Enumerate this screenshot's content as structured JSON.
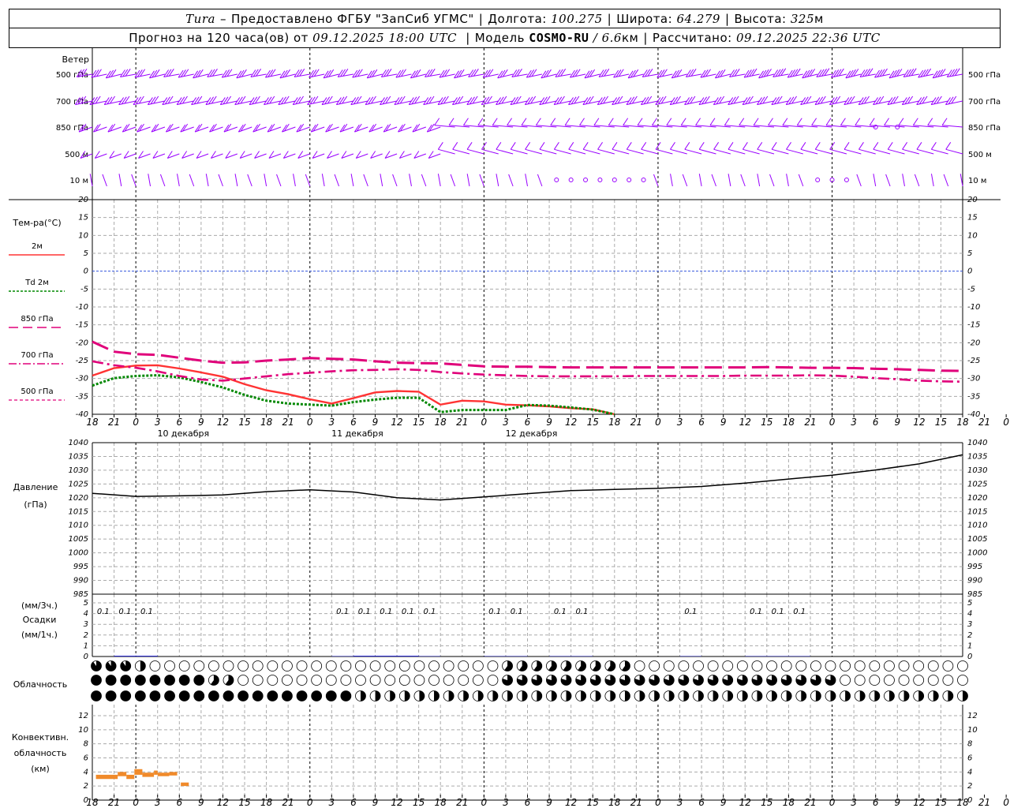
{
  "header": {
    "station": "Tura",
    "dash": "–",
    "provider": "Предоставлено ФГБУ \"ЗапСиб УГМС\"",
    "lon_label": "Долгота:",
    "lon": "100.275",
    "lat_label": "Широта:",
    "lat": "64.279",
    "alt_label": "Высота:",
    "alt": "325",
    "alt_unit": "м",
    "forecast_prefix": "Прогноз на 120 часа(ов) от",
    "forecast_start": "09.12.2025 18:00 UTC",
    "model_label": "Модель",
    "model": "COSMO-RU",
    "model_res": "/ 6.6",
    "model_res_unit": "км",
    "computed_label": "Рассчитано:",
    "computed": "09.12.2025 22:36 UTC"
  },
  "time_axis": {
    "hour_labels": [
      "18",
      "21",
      "0",
      "3",
      "6",
      "9",
      "12",
      "15",
      "18",
      "21",
      "0",
      "3",
      "6",
      "9",
      "12",
      "15",
      "18",
      "21",
      "0",
      "3",
      "6",
      "9",
      "12",
      "15",
      "18",
      "21",
      "0",
      "3",
      "6",
      "9",
      "12",
      "15",
      "18",
      "21",
      "0",
      "3",
      "6",
      "9",
      "12",
      "15",
      "18",
      "21",
      "0"
    ],
    "day_labels": [
      "10 декабря",
      "11 декабря",
      "12 декабря"
    ]
  },
  "wind_panel": {
    "title": "Ветер",
    "levels": [
      "500 гПа",
      "700 гПа",
      "850 гПа",
      "500 м",
      "10 м"
    ],
    "barb_color": "#9900ff"
  },
  "temperature_panel": {
    "title": "Тем-ра(°C)",
    "legend": [
      "2м",
      "Td 2м",
      "850 гПа",
      "700 гПа",
      "500 гПа"
    ],
    "y_ticks": [
      "20",
      "15",
      "10",
      "5",
      "0",
      "-5",
      "-10",
      "-15",
      "-20",
      "-25",
      "-30",
      "-35",
      "-40"
    ]
  },
  "pressure_panel": {
    "title": "Давление",
    "unit": "(гПа)",
    "y_ticks": [
      "1040",
      "1035",
      "1030",
      "1025",
      "1020",
      "1015",
      "1010",
      "1005",
      "1000",
      "995",
      "990",
      "985"
    ]
  },
  "precip_panel": {
    "unit_top": "(мм/3ч.)",
    "title": "Осадки",
    "unit_bottom": "(мм/1ч.)",
    "y_ticks": [
      "5",
      "4",
      "3",
      "2",
      "1",
      "0"
    ],
    "value_label": "0.1"
  },
  "cloud_panel": {
    "title": "Облачность"
  },
  "convective_panel": {
    "title_1": "Конвективн.",
    "title_2": "облачность",
    "unit": "(км)",
    "y_ticks": [
      "12",
      "10",
      "8",
      "6",
      "4",
      "2",
      "0"
    ]
  },
  "chart_data": [
    {
      "type": "line",
      "panel": "temperature",
      "x_hours": [
        0,
        3,
        6,
        9,
        12,
        15,
        18,
        21,
        24,
        27,
        30,
        33,
        36,
        39,
        42,
        45,
        48,
        51,
        54,
        57,
        60,
        63,
        66,
        69,
        72,
        75,
        78,
        81,
        84,
        87,
        90,
        93,
        96,
        99,
        102,
        105,
        108,
        111,
        114,
        117,
        120
      ],
      "ylim": [
        -40,
        20
      ],
      "series": [
        {
          "name": "2м",
          "color": "#ff3333",
          "values": [
            -29.2,
            -27.1,
            -26.4,
            -26.3,
            -27.2,
            -28.3,
            -29.5,
            -31.6,
            -33.3,
            -34.4,
            -35.8,
            -37.0,
            -35.5,
            -33.9,
            -33.5,
            -33.7,
            -37.3,
            -36.2,
            -36.4,
            -37.3,
            -37.5,
            -37.8,
            -38.3,
            -38.6,
            -40.0,
            null,
            null,
            null,
            null,
            null,
            null,
            null,
            null,
            null,
            null,
            null,
            null,
            null,
            null,
            null,
            null
          ]
        },
        {
          "name": "Td 2м",
          "color": "#008800",
          "values": [
            -32.0,
            -29.9,
            -29.3,
            -29.1,
            -29.7,
            -31.0,
            -32.5,
            -34.6,
            -36.2,
            -37.0,
            -37.3,
            -37.6,
            -36.6,
            -35.9,
            -35.4,
            -35.4,
            -39.4,
            -38.8,
            -38.8,
            -38.8,
            -37.4,
            -37.6,
            -38.1,
            -38.7,
            -40.0,
            null,
            null,
            null,
            null,
            null,
            null,
            null,
            null,
            null,
            null,
            null,
            null,
            null,
            null,
            null,
            null
          ]
        },
        {
          "name": "850 гПа",
          "color": "#e0007a",
          "values": [
            -19.7,
            -22.5,
            -23.2,
            -23.4,
            -24.2,
            -25.0,
            -25.6,
            -25.5,
            -25.0,
            -24.7,
            -24.3,
            -24.5,
            -24.7,
            -25.2,
            -25.6,
            -25.7,
            -25.8,
            -26.2,
            -26.6,
            -26.7,
            -26.7,
            -26.8,
            -26.9,
            -26.9,
            -26.9,
            -26.9,
            -26.9,
            -26.9,
            -26.9,
            -26.9,
            -26.9,
            -26.8,
            -26.9,
            -27.0,
            -27.0,
            -27.1,
            -27.3,
            -27.4,
            -27.6,
            -27.8,
            -27.9
          ]
        },
        {
          "name": "700 гПа",
          "color": "#e0007a",
          "values": [
            -25.2,
            -26.3,
            -27.0,
            -28.0,
            -29.3,
            -30.3,
            -30.6,
            -30.0,
            -29.4,
            -28.8,
            -28.4,
            -28.0,
            -27.7,
            -27.6,
            -27.4,
            -27.6,
            -28.2,
            -28.6,
            -28.9,
            -29.1,
            -29.3,
            -29.4,
            -29.4,
            -29.4,
            -29.4,
            -29.3,
            -29.3,
            -29.3,
            -29.3,
            -29.3,
            -29.2,
            -29.2,
            -29.2,
            -29.1,
            -29.2,
            -29.5,
            -29.9,
            -30.2,
            -30.6,
            -30.8,
            -30.9
          ]
        }
      ]
    },
    {
      "type": "line",
      "panel": "pressure",
      "x_hours": [
        0,
        6,
        12,
        18,
        24,
        30,
        36,
        42,
        48,
        54,
        60,
        66,
        72,
        78,
        84,
        90,
        96,
        102,
        108,
        114,
        120
      ],
      "ylim": [
        985,
        1040
      ],
      "series": [
        {
          "name": "Давление",
          "color": "#000000",
          "values": [
            1021.6,
            1020.5,
            1020.7,
            1021.0,
            1022.2,
            1022.9,
            1022.1,
            1020.0,
            1019.2,
            1020.3,
            1021.5,
            1022.6,
            1023.0,
            1023.4,
            1024.1,
            1025.3,
            1026.8,
            1028.2,
            1030.1,
            1032.3,
            1035.6
          ]
        }
      ]
    },
    {
      "type": "bar",
      "panel": "precipitation",
      "x_hours": [
        0,
        3,
        6,
        9,
        12,
        15,
        18,
        21,
        24,
        27,
        30,
        33,
        36,
        39,
        42,
        45,
        48,
        51,
        54,
        57,
        60,
        63,
        66,
        69,
        72,
        75,
        78,
        81,
        84,
        87,
        90,
        93,
        96,
        99,
        102,
        105,
        108,
        111,
        114,
        117,
        120
      ],
      "ylim": [
        0,
        5
      ],
      "series": [
        {
          "name": "мм/3ч",
          "labels_shown": "0.1",
          "values": [
            0.1,
            0.1,
            0.1,
            0,
            0,
            0,
            0,
            0,
            0,
            0,
            0,
            0.1,
            0.1,
            0.1,
            0.1,
            0.1,
            0,
            0,
            0.1,
            0.1,
            0,
            0.1,
            0.1,
            0,
            0,
            0,
            0,
            0.1,
            0,
            0,
            0.1,
            0.1,
            0.1,
            0,
            0,
            0,
            0,
            0,
            0,
            0,
            0
          ]
        },
        {
          "name": "мм/1ч",
          "color": "#0000cc",
          "values": [
            0.0,
            0.1,
            0.1,
            0.0,
            0,
            0,
            0,
            0,
            0,
            0,
            0,
            0.05,
            0.1,
            0.1,
            0.1,
            0.05,
            0,
            0,
            0.05,
            0.05,
            0,
            0.05,
            0.05,
            0,
            0,
            0,
            0,
            0.05,
            0,
            0,
            0.05,
            0.05,
            0.05,
            0,
            0,
            0,
            0,
            0,
            0,
            0,
            0
          ]
        }
      ]
    },
    {
      "type": "bar",
      "panel": "convective",
      "ylim": [
        0,
        13
      ],
      "series": [
        {
          "name": "Конвективная облачность",
          "color": "#f08a2a",
          "segments": [
            {
              "from_h": 0.5,
              "to_h": 3.5,
              "base": 3.0,
              "top": 3.6
            },
            {
              "from_h": 3.5,
              "to_h": 4.7,
              "base": 3.4,
              "top": 4.0
            },
            {
              "from_h": 4.7,
              "to_h": 5.8,
              "base": 3.0,
              "top": 3.6
            },
            {
              "from_h": 5.8,
              "to_h": 6.9,
              "base": 3.6,
              "top": 4.4
            },
            {
              "from_h": 6.9,
              "to_h": 8.5,
              "base": 3.3,
              "top": 3.9
            },
            {
              "from_h": 8.5,
              "to_h": 9.0,
              "base": 3.6,
              "top": 4.2
            },
            {
              "from_h": 9.0,
              "to_h": 10.6,
              "base": 3.4,
              "top": 3.9
            },
            {
              "from_h": 10.6,
              "to_h": 11.7,
              "base": 3.5,
              "top": 4.0
            },
            {
              "from_h": 12.2,
              "to_h": 13.3,
              "base": 2.0,
              "top": 2.5
            }
          ]
        }
      ]
    }
  ]
}
